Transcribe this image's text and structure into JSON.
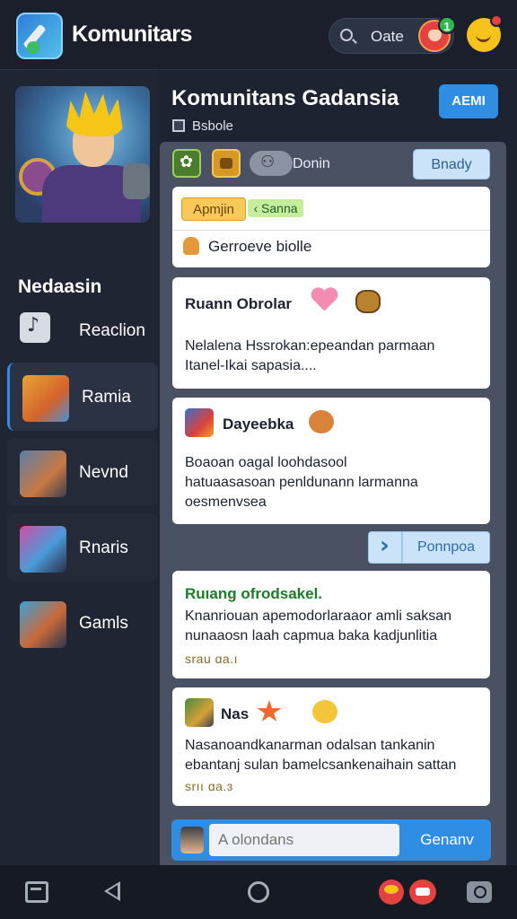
{
  "header": {
    "title": "Komunitars",
    "search_label": "Oate",
    "notif_badge": "1"
  },
  "sidebar": {
    "heading": "Nedaasin",
    "items": [
      {
        "label": "Reaclion",
        "icon": "music-note-icon"
      },
      {
        "label": "Ramia",
        "icon": "hero-ramia-icon"
      },
      {
        "label": "Nevnd",
        "icon": "hero-nevnd-icon"
      },
      {
        "label": "Rnaris",
        "icon": "hero-rnaris-icon"
      },
      {
        "label": "Gamls",
        "icon": "hero-gamls-icon"
      }
    ]
  },
  "main": {
    "title": "Komunitans Gadansia",
    "action_button": "AEMI",
    "subtitle": "Bsbole",
    "toolbar": {
      "label": "Donin",
      "ready_button": "Bnady"
    }
  },
  "cards": [
    {
      "tag_yellow": "Apmjin",
      "tag_green": "Sanna",
      "line": "Gerroeve biolle"
    },
    {
      "title": "Ruann Obrolar",
      "body1": "Nelalena Hssrokan:epeandan parmaan",
      "body2": "Itanel-Ikai sapasia...."
    },
    {
      "title": "Dayeebka",
      "body1": "Boaoan oagal loohdasool",
      "body2": "hatuaasasoan penldunann larmanna",
      "body3": "oesmenvsea"
    },
    {
      "title": "Ruıang ofrodsakel.",
      "body1": "Knanriouan apemodorlaraaor amli saksan",
      "body2": "nunaaosn laah capmua baka kadjunlitia",
      "meta": "srau ɑa.ı"
    },
    {
      "title": "Nas",
      "body1": "Nasanoandkanarman odalsan tankanin",
      "body2": "ebantanj sulan bamelcsankenaihain sattan",
      "meta": "srıı ɑa.ɜ"
    }
  ],
  "reply_button": "Ponnpoa",
  "composer": {
    "placeholder": "A olondans",
    "send_label": "Genanv"
  },
  "colors": {
    "accent": "#2f8de4",
    "background": "#1d2330",
    "card": "#ffffff",
    "active_item": "#2a3244"
  }
}
